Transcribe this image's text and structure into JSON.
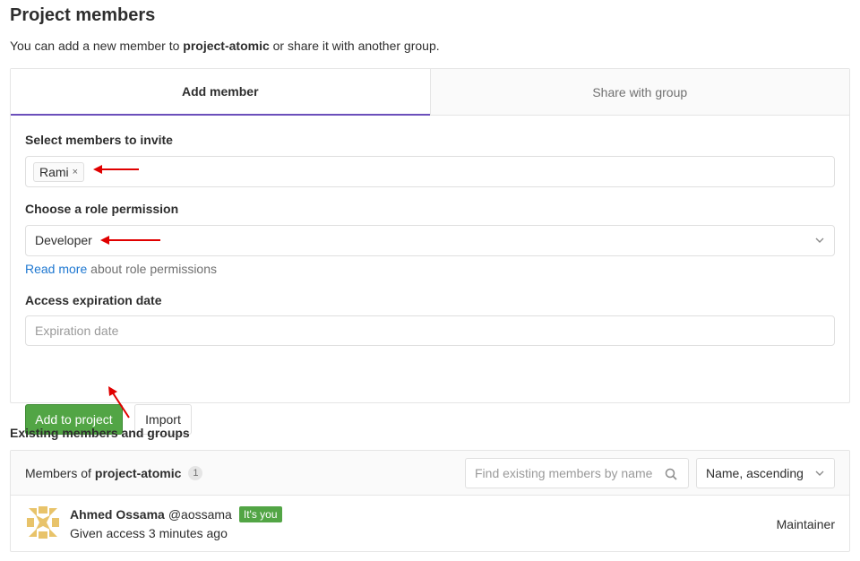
{
  "page": {
    "title": "Project members",
    "intro_before": "You can add a new member to ",
    "intro_project": "project-atomic",
    "intro_after": " or share it with another group."
  },
  "tabs": [
    {
      "label": "Add member",
      "active": true
    },
    {
      "label": "Share with group",
      "active": false
    }
  ],
  "add_member_form": {
    "select_members_label": "Select members to invite",
    "selected_token": "Rami",
    "token_remove_glyph": "×",
    "role_label": "Choose a role permission",
    "role_value": "Developer",
    "read_more_link": "Read more",
    "read_more_suffix": " about role permissions",
    "expiration_label": "Access expiration date",
    "expiration_placeholder": "Expiration date",
    "add_button": "Add to project",
    "import_button": "Import"
  },
  "annotations": {
    "arrow_color": "#e00000"
  },
  "existing": {
    "section_title": "Existing members and groups",
    "members_of_prefix": "Members of ",
    "project_name": "project-atomic",
    "count": "1",
    "search_placeholder": "Find existing members by name",
    "sort_value": "Name, ascending",
    "members": [
      {
        "name": "Ahmed Ossama",
        "handle": "@aossama",
        "badge": "It's you",
        "access": "Given access 3 minutes ago",
        "role": "Maintainer",
        "avatar_icon": "identicon-avatar"
      }
    ]
  },
  "colors": {
    "accent_tab_underline": "#6b4fbb",
    "primary_button": "#52a545",
    "link": "#1f78d1"
  }
}
